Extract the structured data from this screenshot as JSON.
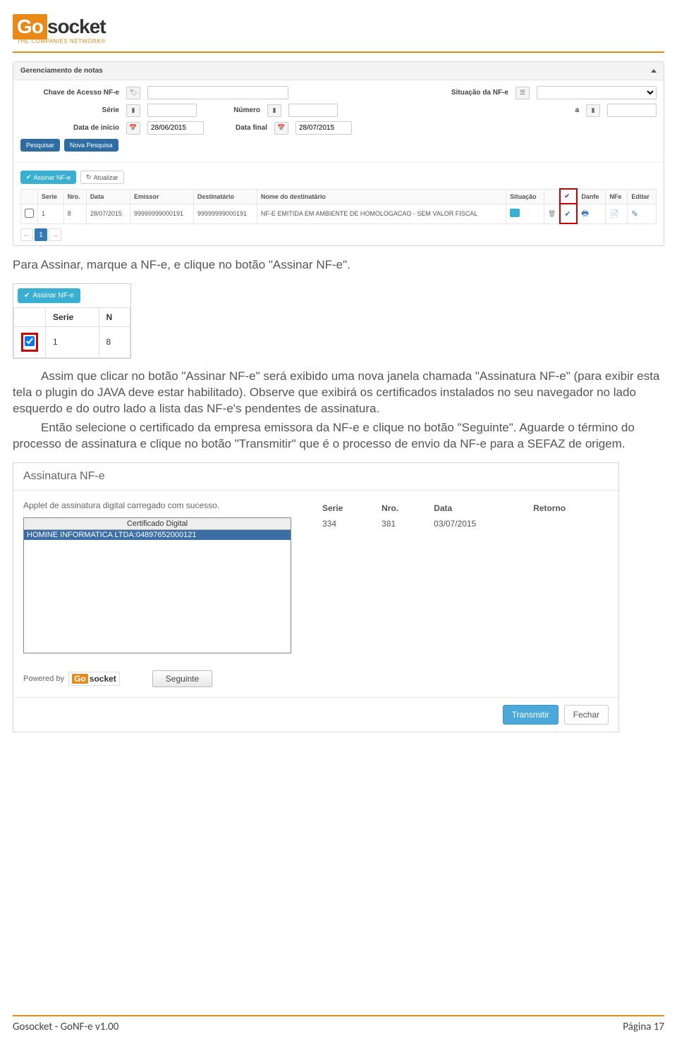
{
  "logo": {
    "go": "Go",
    "socket": "socket",
    "subtitle": "THE COMPANIES NETWORK®"
  },
  "panel1": {
    "title": "Gerenciamento de notas",
    "labels": {
      "chave": "Chave de Acesso NF-e",
      "situacao": "Situação da NF-e",
      "serie": "Série",
      "numero": "Número",
      "a": "a",
      "dataInicio": "Data de início",
      "dataFinal": "Data final"
    },
    "dates": {
      "inicio": "28/06/2015",
      "final": "28/07/2015"
    },
    "buttons": {
      "pesquisar": "Pesquisar",
      "novaPesquisa": "Nova Pesquisa",
      "assinar": "Assinar NF-e",
      "atualizar": "Atualizar"
    },
    "headers": [
      "",
      "Serie",
      "Nro.",
      "Data",
      "Emissor",
      "Destinatário",
      "Nome do destinatário",
      "Situação",
      "",
      "✔",
      "Danfe",
      "NFe",
      "Editar"
    ],
    "row": {
      "serie": "1",
      "nro": "8",
      "data": "28/07/2015",
      "emissor": "99999999000191",
      "dest": "99999999000191",
      "nome": "NF-E EMITIDA EM AMBIENTE DE HOMOLOGACAO - SEM VALOR FISCAL"
    },
    "pager": {
      "prev": "←",
      "page": "1",
      "next": "→"
    }
  },
  "para1": "Para Assinar, marque a NF-e, e clique no botão \"Assinar NF-e\".",
  "shot2": {
    "btn": "Assinar NF-e",
    "h1": "Serie",
    "h2": "N",
    "v1": "1",
    "v2": "8"
  },
  "para2a": "Assim que clicar no botão \"Assinar NF-e\" será exibido uma nova janela chamada \"Assinatura NF-e\" (para exibir esta tela o plugin do JAVA deve estar habilitado). Observe que exibirá os certificados instalados no seu navegador no lado esquerdo e do outro lado a lista das NF-e's pendentes de assinatura.",
  "para2b": "Então selecione o certificado da empresa emissora da NF-e e clique no botão \"Seguinte\". Aguarde o término do processo de assinatura e clique no botão \"Transmitir\" que é o processo de envio da NF-e para a SEFAZ de origem.",
  "dlg": {
    "title": "Assinatura NF-e",
    "applet": "Applet de assinatura digital carregado com sucesso.",
    "certHead": "Certificado Digital",
    "certItem": "HOMINE INFORMATICA LTDA:04897652000121",
    "headers": {
      "serie": "Serie",
      "nro": "Nro.",
      "data": "Data",
      "retorno": "Retorno"
    },
    "row": {
      "serie": "334",
      "nro": "381",
      "data": "03/07/2015",
      "retorno": ""
    },
    "powered": "Powered by",
    "seguinte": "Seguinte",
    "transmitir": "Transmitir",
    "fechar": "Fechar"
  },
  "footer": {
    "left": "Gosocket - GoNF-e v1.00",
    "right": "Página 17"
  }
}
